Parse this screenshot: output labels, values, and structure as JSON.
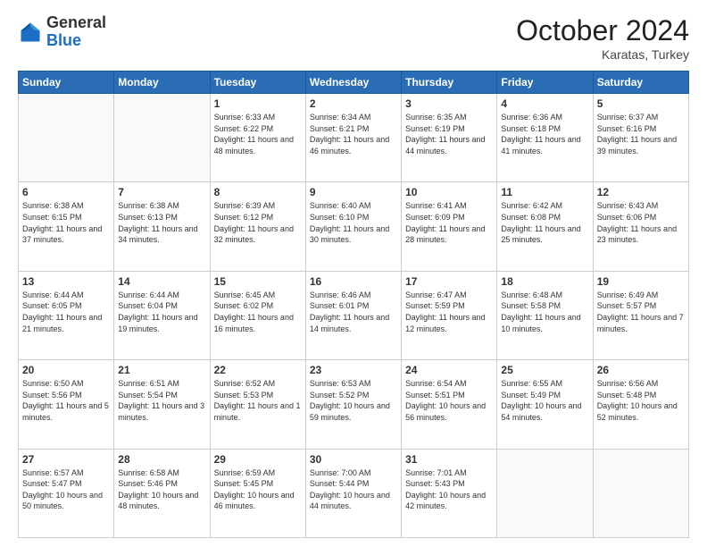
{
  "header": {
    "logo_line1": "General",
    "logo_line2": "Blue",
    "month": "October 2024",
    "location": "Karatas, Turkey"
  },
  "days_of_week": [
    "Sunday",
    "Monday",
    "Tuesday",
    "Wednesday",
    "Thursday",
    "Friday",
    "Saturday"
  ],
  "weeks": [
    [
      {
        "day": "",
        "info": ""
      },
      {
        "day": "",
        "info": ""
      },
      {
        "day": "1",
        "info": "Sunrise: 6:33 AM\nSunset: 6:22 PM\nDaylight: 11 hours and 48 minutes."
      },
      {
        "day": "2",
        "info": "Sunrise: 6:34 AM\nSunset: 6:21 PM\nDaylight: 11 hours and 46 minutes."
      },
      {
        "day": "3",
        "info": "Sunrise: 6:35 AM\nSunset: 6:19 PM\nDaylight: 11 hours and 44 minutes."
      },
      {
        "day": "4",
        "info": "Sunrise: 6:36 AM\nSunset: 6:18 PM\nDaylight: 11 hours and 41 minutes."
      },
      {
        "day": "5",
        "info": "Sunrise: 6:37 AM\nSunset: 6:16 PM\nDaylight: 11 hours and 39 minutes."
      }
    ],
    [
      {
        "day": "6",
        "info": "Sunrise: 6:38 AM\nSunset: 6:15 PM\nDaylight: 11 hours and 37 minutes."
      },
      {
        "day": "7",
        "info": "Sunrise: 6:38 AM\nSunset: 6:13 PM\nDaylight: 11 hours and 34 minutes."
      },
      {
        "day": "8",
        "info": "Sunrise: 6:39 AM\nSunset: 6:12 PM\nDaylight: 11 hours and 32 minutes."
      },
      {
        "day": "9",
        "info": "Sunrise: 6:40 AM\nSunset: 6:10 PM\nDaylight: 11 hours and 30 minutes."
      },
      {
        "day": "10",
        "info": "Sunrise: 6:41 AM\nSunset: 6:09 PM\nDaylight: 11 hours and 28 minutes."
      },
      {
        "day": "11",
        "info": "Sunrise: 6:42 AM\nSunset: 6:08 PM\nDaylight: 11 hours and 25 minutes."
      },
      {
        "day": "12",
        "info": "Sunrise: 6:43 AM\nSunset: 6:06 PM\nDaylight: 11 hours and 23 minutes."
      }
    ],
    [
      {
        "day": "13",
        "info": "Sunrise: 6:44 AM\nSunset: 6:05 PM\nDaylight: 11 hours and 21 minutes."
      },
      {
        "day": "14",
        "info": "Sunrise: 6:44 AM\nSunset: 6:04 PM\nDaylight: 11 hours and 19 minutes."
      },
      {
        "day": "15",
        "info": "Sunrise: 6:45 AM\nSunset: 6:02 PM\nDaylight: 11 hours and 16 minutes."
      },
      {
        "day": "16",
        "info": "Sunrise: 6:46 AM\nSunset: 6:01 PM\nDaylight: 11 hours and 14 minutes."
      },
      {
        "day": "17",
        "info": "Sunrise: 6:47 AM\nSunset: 5:59 PM\nDaylight: 11 hours and 12 minutes."
      },
      {
        "day": "18",
        "info": "Sunrise: 6:48 AM\nSunset: 5:58 PM\nDaylight: 11 hours and 10 minutes."
      },
      {
        "day": "19",
        "info": "Sunrise: 6:49 AM\nSunset: 5:57 PM\nDaylight: 11 hours and 7 minutes."
      }
    ],
    [
      {
        "day": "20",
        "info": "Sunrise: 6:50 AM\nSunset: 5:56 PM\nDaylight: 11 hours and 5 minutes."
      },
      {
        "day": "21",
        "info": "Sunrise: 6:51 AM\nSunset: 5:54 PM\nDaylight: 11 hours and 3 minutes."
      },
      {
        "day": "22",
        "info": "Sunrise: 6:52 AM\nSunset: 5:53 PM\nDaylight: 11 hours and 1 minute."
      },
      {
        "day": "23",
        "info": "Sunrise: 6:53 AM\nSunset: 5:52 PM\nDaylight: 10 hours and 59 minutes."
      },
      {
        "day": "24",
        "info": "Sunrise: 6:54 AM\nSunset: 5:51 PM\nDaylight: 10 hours and 56 minutes."
      },
      {
        "day": "25",
        "info": "Sunrise: 6:55 AM\nSunset: 5:49 PM\nDaylight: 10 hours and 54 minutes."
      },
      {
        "day": "26",
        "info": "Sunrise: 6:56 AM\nSunset: 5:48 PM\nDaylight: 10 hours and 52 minutes."
      }
    ],
    [
      {
        "day": "27",
        "info": "Sunrise: 6:57 AM\nSunset: 5:47 PM\nDaylight: 10 hours and 50 minutes."
      },
      {
        "day": "28",
        "info": "Sunrise: 6:58 AM\nSunset: 5:46 PM\nDaylight: 10 hours and 48 minutes."
      },
      {
        "day": "29",
        "info": "Sunrise: 6:59 AM\nSunset: 5:45 PM\nDaylight: 10 hours and 46 minutes."
      },
      {
        "day": "30",
        "info": "Sunrise: 7:00 AM\nSunset: 5:44 PM\nDaylight: 10 hours and 44 minutes."
      },
      {
        "day": "31",
        "info": "Sunrise: 7:01 AM\nSunset: 5:43 PM\nDaylight: 10 hours and 42 minutes."
      },
      {
        "day": "",
        "info": ""
      },
      {
        "day": "",
        "info": ""
      }
    ]
  ]
}
